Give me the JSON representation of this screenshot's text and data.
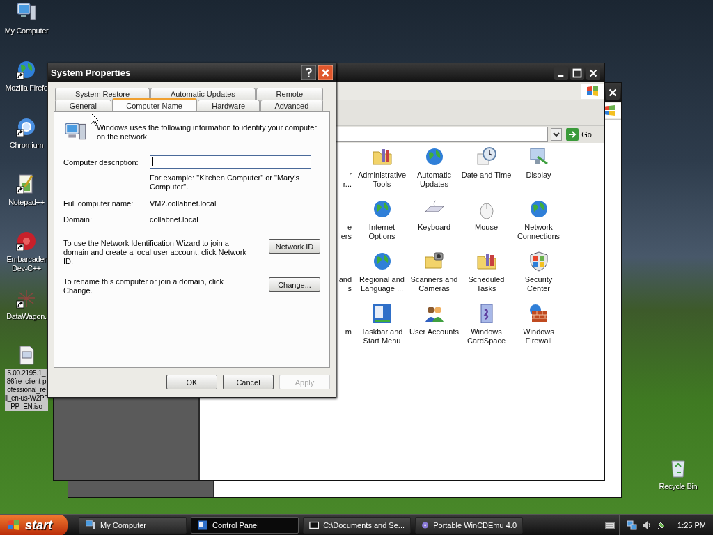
{
  "desktop": {
    "icons": [
      {
        "label": "My Computer",
        "shortcut": false,
        "selected": false
      },
      {
        "label": "Mozilla Firefo",
        "shortcut": true,
        "selected": false
      },
      {
        "label": "Chromium",
        "shortcut": true,
        "selected": false
      },
      {
        "label": "Notepad++",
        "shortcut": true,
        "selected": false
      },
      {
        "label": "Embarcader\nDev-C++",
        "shortcut": true,
        "selected": false
      },
      {
        "label": "DataWagon.",
        "shortcut": true,
        "selected": false
      },
      {
        "label": "5.00.2195.1_\n86fre_client-p\nofessional_re\nil_en-us-W2PF\nPP_EN.iso",
        "shortcut": false,
        "selected": true
      }
    ],
    "recycle_bin": {
      "label": "Recycle Bin"
    }
  },
  "control_panel": {
    "go": "Go",
    "partial_items": [
      {
        "label": "r\nr..."
      },
      {
        "label": "e\nlers"
      },
      {
        "label": "and\ns"
      },
      {
        "label": "m"
      }
    ],
    "items": [
      {
        "label": "Administrative\nTools"
      },
      {
        "label": "Automatic\nUpdates"
      },
      {
        "label": "Date and Time"
      },
      {
        "label": "Display"
      },
      {
        "label": "Internet\nOptions"
      },
      {
        "label": "Keyboard"
      },
      {
        "label": "Mouse"
      },
      {
        "label": "Network\nConnections"
      },
      {
        "label": "Regional and\nLanguage ..."
      },
      {
        "label": "Scanners and\nCameras"
      },
      {
        "label": "Scheduled\nTasks"
      },
      {
        "label": "Security\nCenter"
      },
      {
        "label": "Taskbar and\nStart Menu"
      },
      {
        "label": "User Accounts"
      },
      {
        "label": "Windows\nCardSpace"
      },
      {
        "label": "Windows\nFirewall"
      }
    ]
  },
  "dialog": {
    "title": "System Properties",
    "tab_rows": [
      [
        {
          "label": "System Restore",
          "selected": false
        },
        {
          "label": "Automatic Updates",
          "selected": false
        },
        {
          "label": "Remote",
          "selected": false
        }
      ],
      [
        {
          "label": "General",
          "selected": false
        },
        {
          "label": "Computer Name",
          "selected": true
        },
        {
          "label": "Hardware",
          "selected": false
        },
        {
          "label": "Advanced",
          "selected": false
        }
      ]
    ],
    "intro": "Windows uses the following information to identify your computer on the network.",
    "description": {
      "label": "Computer description:",
      "focused": true
    },
    "hint": "For example: \"Kitchen Computer\" or \"Mary's Computer\".",
    "fields": [
      {
        "label": "Full computer name:",
        "value": "VM2.collabnet.local"
      },
      {
        "label": "Domain:",
        "value": "collabnet.local"
      }
    ],
    "actions": [
      {
        "text": "To use the Network Identification Wizard to join a domain and create a local user account, click Network ID.",
        "button": "Network ID"
      },
      {
        "text": "To rename this computer or join a domain, click Change.",
        "button": "Change..."
      }
    ],
    "buttons": [
      {
        "label": "OK",
        "disabled": false
      },
      {
        "label": "Cancel",
        "disabled": false
      },
      {
        "label": "Apply",
        "disabled": true
      }
    ]
  },
  "taskbar": {
    "start": "start",
    "items": [
      {
        "label": "My Computer",
        "selected": false
      },
      {
        "label": "Control Panel",
        "selected": true
      },
      {
        "label": "C:\\Documents and Se...",
        "selected": false
      },
      {
        "label": "Portable WinCDEmu 4.0",
        "selected": false
      }
    ],
    "clock": "1:25 PM"
  }
}
